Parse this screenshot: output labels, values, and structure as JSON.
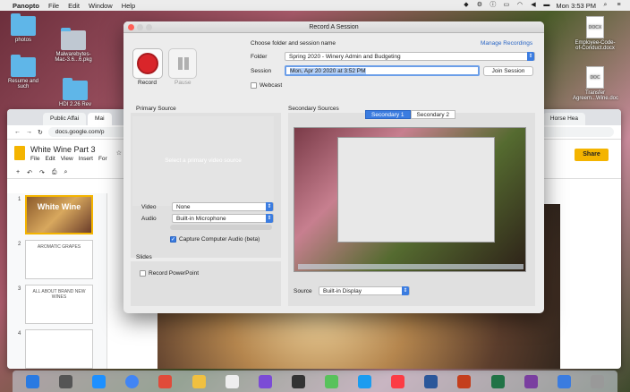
{
  "menubar": {
    "app": "Panopto",
    "items": [
      "File",
      "Edit",
      "Window",
      "Help"
    ],
    "clock": "Mon 3:53 PM"
  },
  "desktop": {
    "left_icons": [
      {
        "label": "photos"
      },
      {
        "label": "Malwarebytes-Mac-3.6...6.pkg"
      },
      {
        "label": "Resume and such"
      },
      {
        "label": "HDI 2.26 Rev"
      }
    ],
    "right_icons": [
      {
        "label": "Employee-Code-of-Conduct.docx",
        "type": "DOCX"
      },
      {
        "label": "Transfer Agreem...Wine.doc",
        "type": "DOC"
      }
    ]
  },
  "browser": {
    "tabs": [
      "Public Affai",
      "Mai",
      "Horse Hea"
    ],
    "address": "docs.google.com/p",
    "doc_title": "White Wine Part 3",
    "doc_menu": [
      "File",
      "Edit",
      "View",
      "Insert",
      "For"
    ],
    "share_label": "Share",
    "slides": [
      {
        "num": "1",
        "text": "White Wine"
      },
      {
        "num": "2",
        "text": "AROMATIC GRAPES"
      },
      {
        "num": "3",
        "text": "ALL ABOUT BRAND NEW WINES"
      },
      {
        "num": "4",
        "text": ""
      }
    ]
  },
  "dialog": {
    "title": "Record A Session",
    "record_label": "Record",
    "pause_label": "Pause",
    "choose_label": "Choose folder and session name",
    "manage_link": "Manage Recordings",
    "folder_label": "Folder",
    "folder_value": "Spring 2020 - Winery Admin and Budgeting",
    "session_label": "Session",
    "session_value": "Mon, Apr 20 2020 at 3:52 PM",
    "join_session": "Join Session",
    "webcast_label": "Webcast",
    "webcast_checked": false,
    "primary_source_heading": "Primary Source",
    "primary_preview_text": "Select a primary video source",
    "video_label": "Video",
    "video_value": "None",
    "audio_label": "Audio",
    "audio_value": "Built-in Microphone",
    "capture_audio_label": "Capture Computer Audio (beta)",
    "capture_audio_checked": true,
    "slides_heading": "Slides",
    "record_ppt_label": "Record PowerPoint",
    "record_ppt_checked": false,
    "secondary_heading": "Secondary Sources",
    "secondary_tabs": [
      "Secondary 1",
      "Secondary 2"
    ],
    "secondary_active": "Secondary 1",
    "source_label": "Source",
    "source_value": "Built-in Display"
  },
  "colors": {
    "accent": "#3b7ce0",
    "record_red": "#d9252a",
    "share_yellow": "#f4b400"
  }
}
